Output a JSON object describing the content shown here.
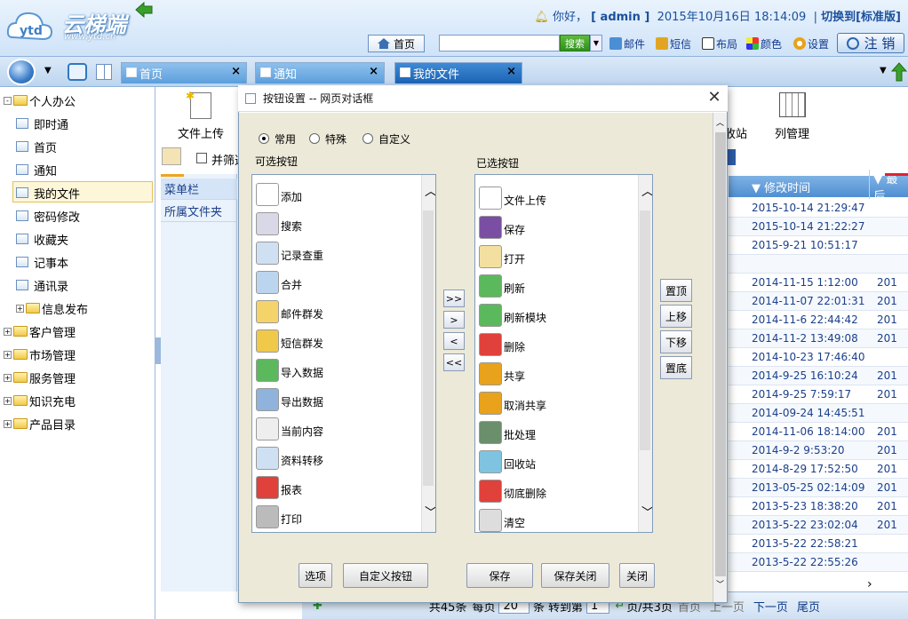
{
  "header": {
    "logo_text": "云梯端",
    "logo_url": "www.ytd.cn",
    "greeting": "你好，",
    "user": "[ admin ]",
    "datetime": "2015年10月16日 18:14:09",
    "switch": "切换到[标准版]",
    "home": "首页",
    "search_btn": "搜索",
    "mail": "邮件",
    "sms": "短信",
    "layout": "布局",
    "color": "颜色",
    "settings": "设置",
    "logout": "注 销"
  },
  "tabs": [
    {
      "label": "首页"
    },
    {
      "label": "通知"
    },
    {
      "label": "我的文件"
    }
  ],
  "sidebar": {
    "items": [
      {
        "label": "个人办公",
        "type": "folder",
        "mark": "-"
      },
      {
        "label": "即时通",
        "type": "doc"
      },
      {
        "label": "首页",
        "type": "doc"
      },
      {
        "label": "通知",
        "type": "doc"
      },
      {
        "label": "我的文件",
        "type": "doc"
      },
      {
        "label": "密码修改",
        "type": "doc"
      },
      {
        "label": "收藏夹",
        "type": "doc"
      },
      {
        "label": "记事本",
        "type": "doc"
      },
      {
        "label": "通讯录",
        "type": "doc"
      },
      {
        "label": "信息发布",
        "type": "subfolder",
        "mark": "+"
      },
      {
        "label": "客户管理",
        "type": "folder",
        "mark": "+"
      },
      {
        "label": "市场管理",
        "type": "folder",
        "mark": "+"
      },
      {
        "label": "服务管理",
        "type": "folder",
        "mark": "+"
      },
      {
        "label": "知识充电",
        "type": "folder",
        "mark": "+"
      },
      {
        "label": "产品目录",
        "type": "folder",
        "mark": "+"
      }
    ]
  },
  "toolbar": {
    "upload": "文件上传",
    "recycle": "收站",
    "columns": "列管理",
    "filter": "并筛选"
  },
  "mid_panel": {
    "menu": "菜单栏",
    "folder": "所属文件夹"
  },
  "grid": {
    "col_modified": "修改时间",
    "col_last": "最后",
    "rows": [
      {
        "time": "2015-10-14 21:29:47",
        "extra": ""
      },
      {
        "time": "2015-10-14 21:22:27",
        "extra": ""
      },
      {
        "time": "2015-9-21 10:51:17",
        "extra": ""
      },
      {
        "time": "",
        "extra": ""
      },
      {
        "time": "2014-11-15 1:12:00",
        "extra": "201"
      },
      {
        "time": "2014-11-07 22:01:31",
        "extra": "201"
      },
      {
        "time": "2014-11-6 22:44:42",
        "extra": "201"
      },
      {
        "time": "2014-11-2 13:49:08",
        "extra": "201"
      },
      {
        "time": "2014-10-23 17:46:40",
        "extra": ""
      },
      {
        "time": "2014-9-25 16:10:24",
        "extra": "201"
      },
      {
        "time": "2014-9-25 7:59:17",
        "extra": "201"
      },
      {
        "time": "2014-09-24 14:45:51",
        "extra": ""
      },
      {
        "time": "2014-11-06 18:14:00",
        "extra": "201"
      },
      {
        "time": "2014-9-2 9:53:20",
        "extra": "201"
      },
      {
        "time": "2014-8-29 17:52:50",
        "extra": "201"
      },
      {
        "time": "2013-05-25 02:14:09",
        "extra": "201"
      },
      {
        "time": "2013-5-23 18:38:20",
        "extra": "201"
      },
      {
        "time": "2013-5-22 23:02:04",
        "extra": "201"
      },
      {
        "time": "2013-5-22 22:58:21",
        "extra": ""
      },
      {
        "time": "2013-5-22 22:55:26",
        "extra": ""
      }
    ]
  },
  "pager": {
    "total": "共45条",
    "per_page": "每页",
    "size": "20",
    "unit": "条",
    "jump": "转到第",
    "page": "1",
    "pages": "页/共3页",
    "first": "首页",
    "prev": "上一页",
    "next": "下一页",
    "last": "尾页"
  },
  "dialog": {
    "title": "按钮设置 -- 网页对话框",
    "radios": [
      {
        "label": "常用",
        "checked": true
      },
      {
        "label": "特殊",
        "checked": false
      },
      {
        "label": "自定义",
        "checked": false
      }
    ],
    "available_label": "可选按钮",
    "selected_label": "已选按钮",
    "available": [
      "添加",
      "搜索",
      "记录查重",
      "合并",
      "邮件群发",
      "短信群发",
      "导入数据",
      "导出数据",
      "当前内容",
      "资料转移",
      "报表",
      "打印"
    ],
    "selected": [
      "文件上传",
      "保存",
      "打开",
      "刷新",
      "刷新模块",
      "删除",
      "共享",
      "取消共享",
      "批处理",
      "回收站",
      "彻底删除",
      "清空"
    ],
    "move": [
      ">>",
      ">",
      "<",
      "<<"
    ],
    "order": [
      "置顶",
      "上移",
      "下移",
      "置底"
    ],
    "buttons": {
      "options": "选项",
      "custom": "自定义按钮",
      "save": "保存",
      "save_close": "保存关闭",
      "close": "关闭"
    }
  }
}
